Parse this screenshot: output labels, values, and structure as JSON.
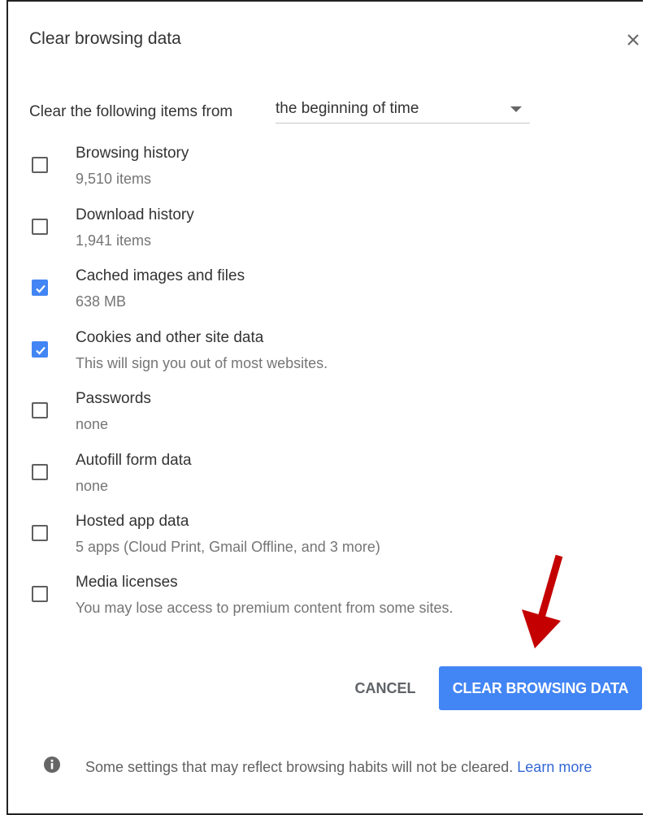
{
  "dialog": {
    "title": "Clear browsing data",
    "range_label": "Clear the following items from",
    "range_value": "the beginning of time"
  },
  "items": [
    {
      "title": "Browsing history",
      "subtitle": "9,510 items",
      "checked": false
    },
    {
      "title": "Download history",
      "subtitle": "1,941 items",
      "checked": false
    },
    {
      "title": "Cached images and files",
      "subtitle": "638 MB",
      "checked": true
    },
    {
      "title": "Cookies and other site data",
      "subtitle": "This will sign you out of most websites.",
      "checked": true
    },
    {
      "title": "Passwords",
      "subtitle": "none",
      "checked": false
    },
    {
      "title": "Autofill form data",
      "subtitle": "none",
      "checked": false
    },
    {
      "title": "Hosted app data",
      "subtitle": "5 apps (Cloud Print, Gmail Offline, and 3 more)",
      "checked": false
    },
    {
      "title": "Media licenses",
      "subtitle": "You may lose access to premium content from some sites.",
      "checked": false
    }
  ],
  "buttons": {
    "cancel": "CANCEL",
    "clear": "CLEAR BROWSING DATA"
  },
  "footer": {
    "info_text": "Some settings that may reflect browsing habits will not be cleared.",
    "learn_more": "Learn more"
  },
  "colors": {
    "accent": "#4285f4",
    "annotation_arrow": "#c40000",
    "link": "#3367d6"
  },
  "icons": {
    "close": "close-icon",
    "dropdown": "chevron-down-icon",
    "checkmark": "checkmark-icon",
    "info": "info-icon",
    "annotation": "red-arrow-icon"
  }
}
